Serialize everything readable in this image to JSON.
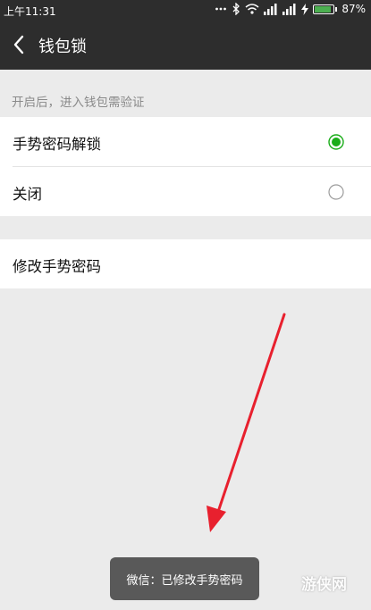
{
  "status_bar": {
    "time": "上午11:31",
    "battery_percent": "87%",
    "battery_level": 0.87,
    "icons": [
      "more-icon",
      "bluetooth-icon",
      "wifi-icon",
      "signal-icon",
      "signal-icon",
      "charging-icon",
      "battery-icon"
    ]
  },
  "header": {
    "title": "钱包锁",
    "back_icon": "back-arrow-icon"
  },
  "hint": "开启后，进入钱包需验证",
  "options": [
    {
      "label": "手势密码解锁",
      "selected": true
    },
    {
      "label": "关闭",
      "selected": false
    }
  ],
  "modify_label": "修改手势密码",
  "toast": "微信：已修改手势密码",
  "watermark": "游侠网",
  "colors": {
    "accent": "#1aad19",
    "header_bg": "#2d2d2d",
    "page_bg": "#ebebeb",
    "annotation_arrow": "#e8202e"
  }
}
